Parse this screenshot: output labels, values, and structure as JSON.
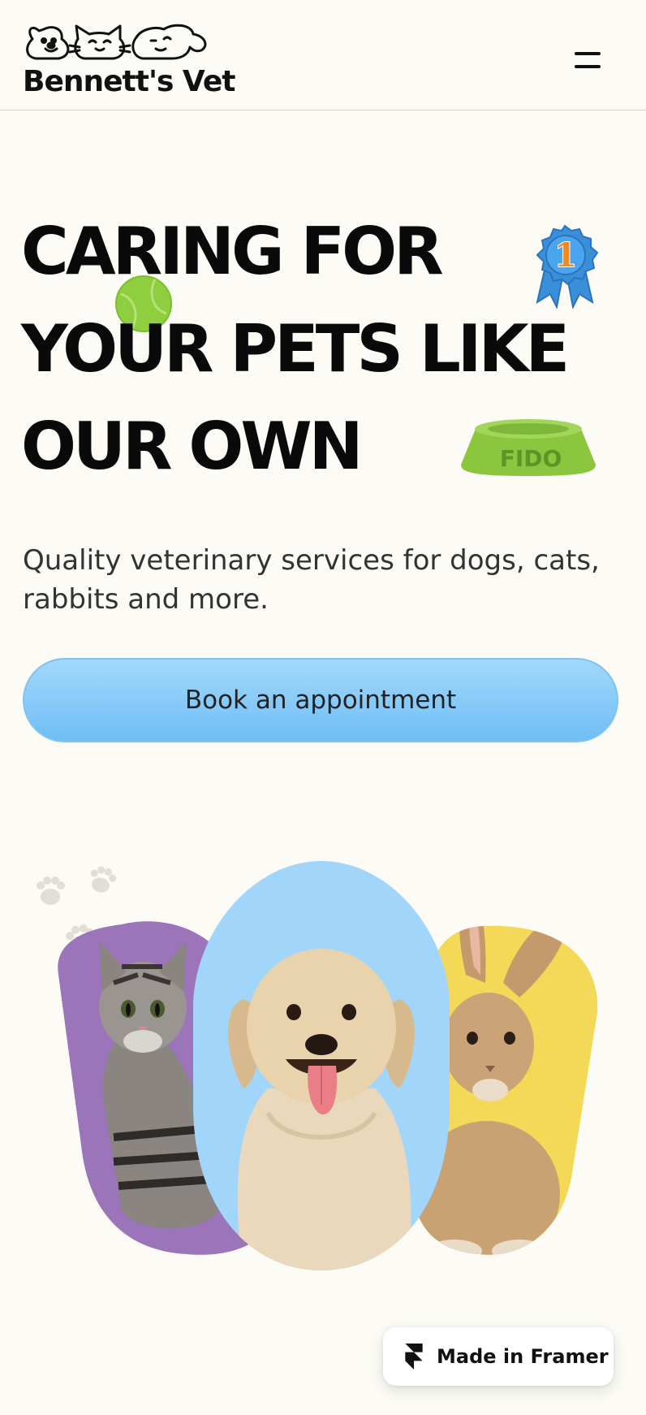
{
  "header": {
    "logo_text": "Bennett's Vet",
    "menu_icon": "hamburger-menu-icon"
  },
  "hero": {
    "title": "CARING FOR YOUR PETS LIKE OUR OWN",
    "subtitle": "Quality veterinary services for dogs, cats, rabbits and more.",
    "ribbon_number": "1",
    "bowl_label": "FIDO",
    "cta_label": "Book an appointment"
  },
  "badge": {
    "label": "Made in Framer"
  },
  "colors": {
    "background": "#fcfbf5",
    "cta_top": "#a3d8fb",
    "cta_bottom": "#6fbef6",
    "cat_bg": "#9b74ba",
    "dog_bg": "#a1d6fa",
    "rabbit_bg": "#f3d957",
    "ball": "#8fcf3f",
    "ribbon": "#3a8fd8",
    "bowl": "#8cc63f"
  }
}
